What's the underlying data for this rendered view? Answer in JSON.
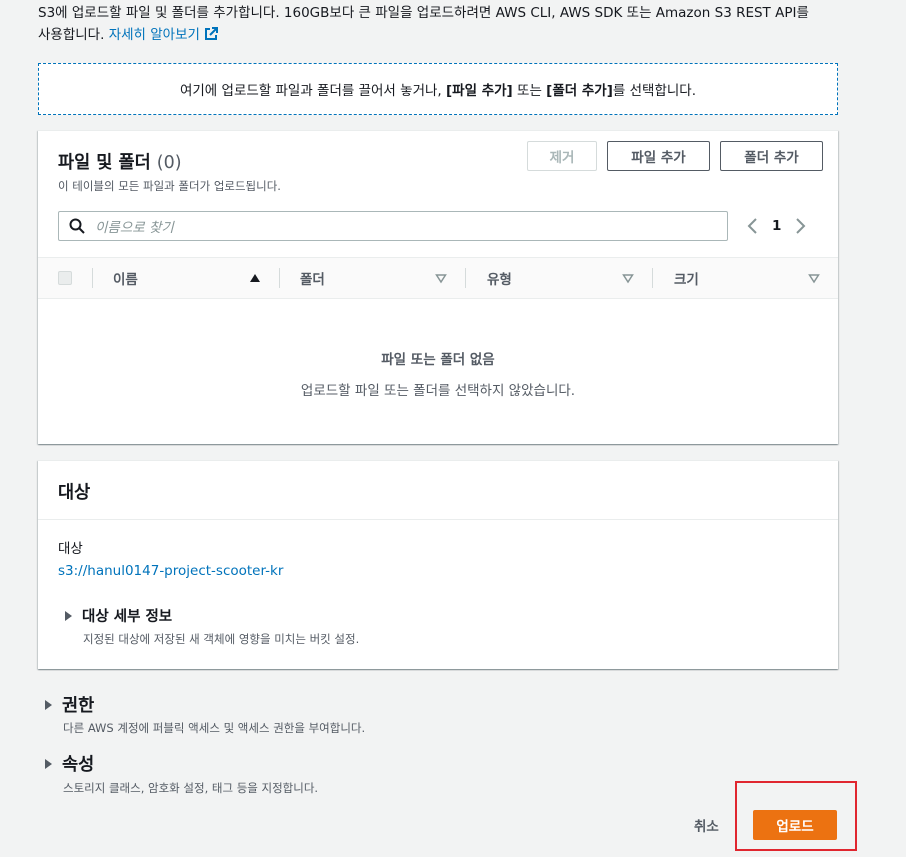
{
  "intro": {
    "line1": "S3에 업로드할 파일 및 폴더를 추가합니다. 160GB보다 큰 파일을 업로드하려면 AWS CLI, AWS SDK 또는 Amazon S3 REST API를",
    "line2_prefix": "사용합니다.",
    "learn_more": "자세히 알아보기"
  },
  "dropzone": {
    "text_before": "여기에 업로드할 파일과 폴더를 끌어서 놓거나,",
    "bold_add_files": "[파일 추가]",
    "text_middle": "또는",
    "bold_add_folder": "[폴더 추가]",
    "text_after": "를 선택합니다."
  },
  "files_panel": {
    "title": "파일 및 폴더",
    "count": "(0)",
    "description": "이 테이블의 모든 파일과 폴더가 업로드됩니다.",
    "remove_button": "제거",
    "add_files_button": "파일 추가",
    "add_folder_button": "폴더 추가",
    "search_placeholder": "이름으로 찾기",
    "page_number": "1",
    "columns": [
      "이름",
      "폴더",
      "유형",
      "크기"
    ],
    "empty_title": "파일 또는 폴더 없음",
    "empty_description": "업로드할 파일 또는 폴더를 선택하지 않았습니다."
  },
  "target_panel": {
    "title": "대상",
    "label": "대상",
    "destination": "s3://hanul0147-project-scooter-kr",
    "details_title": "대상 세부 정보",
    "details_description": "지정된 대상에 저장된 새 객체에 영향을 미치는 버킷 설정."
  },
  "permissions": {
    "title": "권한",
    "description": "다른 AWS 계정에 퍼블릭 액세스 및 액세스 권한을 부여합니다."
  },
  "properties": {
    "title": "속성",
    "description": "스토리지 클래스, 암호화 설정, 태그 등을 지정합니다."
  },
  "footer": {
    "cancel": "취소",
    "upload": "업로드"
  },
  "colors": {
    "link": "#0073bb",
    "primary_button": "#ec7211",
    "highlight": "#e0262f"
  },
  "icons": [
    "external-link-icon",
    "search-icon",
    "chevron-left-icon",
    "chevron-right-icon",
    "sort-ascending-icon",
    "sort-icon",
    "caret-right-icon"
  ]
}
